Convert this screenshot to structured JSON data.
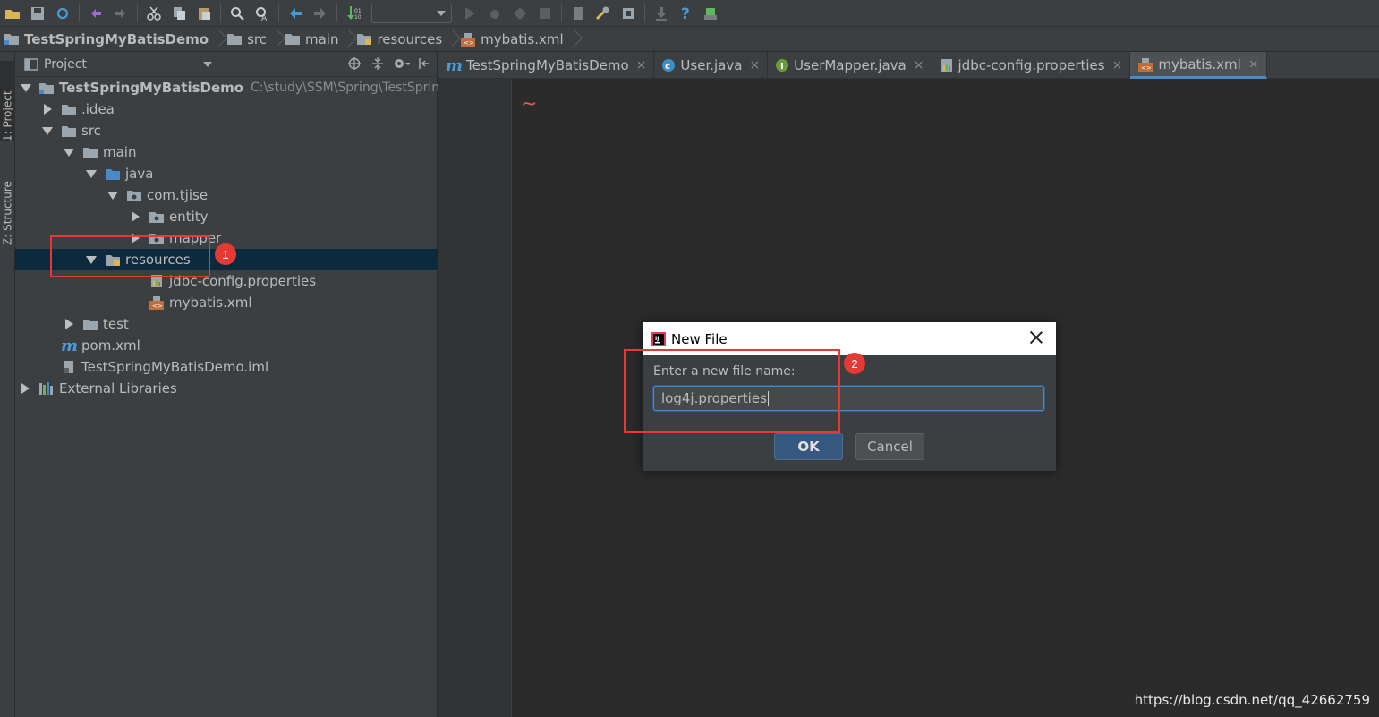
{
  "toolbar": {
    "icons": [
      "open-icon",
      "save-icon",
      "sync-icon",
      "undo-icon",
      "redo-icon",
      "cut-icon",
      "copy-icon",
      "paste-icon",
      "find-icon",
      "replace-icon",
      "back-icon",
      "forward-icon",
      "build-icon",
      "run-config-combo",
      "run-icon",
      "debug-icon",
      "coverage-icon",
      "stop-icon",
      "project-structure-icon",
      "settings-icon",
      "sdk-icon",
      "vcs-icon",
      "help-icon",
      "plugin-icon"
    ]
  },
  "breadcrumb": {
    "items": [
      "TestSpringMyBatisDemo",
      "src",
      "main",
      "resources",
      "mybatis.xml"
    ]
  },
  "left_strip": {
    "project_tab": "1: Project",
    "structure_tab": "Z: Structure"
  },
  "project_panel": {
    "title": "Project",
    "tree": [
      {
        "label": "TestSpringMyBatisDemo",
        "path": "C:\\study\\SSM\\Spring\\TestSprin"
      },
      {
        "label": ".idea"
      },
      {
        "label": "src"
      },
      {
        "label": "main"
      },
      {
        "label": "java"
      },
      {
        "label": "com.tjise"
      },
      {
        "label": "entity"
      },
      {
        "label": "mapper"
      },
      {
        "label": "resources"
      },
      {
        "label": "jdbc-config.properties"
      },
      {
        "label": "mybatis.xml"
      },
      {
        "label": "test"
      },
      {
        "label": "pom.xml"
      },
      {
        "label": "TestSpringMyBatisDemo.iml"
      },
      {
        "label": "External Libraries"
      }
    ]
  },
  "editor_tabs": [
    {
      "label": "TestSpringMyBatisDemo",
      "close": "×"
    },
    {
      "label": "User.java",
      "close": "×"
    },
    {
      "label": "UserMapper.java",
      "close": "×"
    },
    {
      "label": "jdbc-config.properties",
      "close": "×"
    },
    {
      "label": "mybatis.xml",
      "close": "×"
    }
  ],
  "editor": {
    "tilde": "~",
    "watermark": "https://blog.csdn.net/qq_42662759"
  },
  "dialog": {
    "title": "New File",
    "label": "Enter a new file name:",
    "input_value": "log4j.properties",
    "ok_label": "OK",
    "cancel_label": "Cancel"
  },
  "annotations": {
    "badge1": "1",
    "badge2": "2",
    "color": "#e53935"
  },
  "colors": {
    "selection": "#0d293e",
    "accent": "#4a88c7"
  }
}
